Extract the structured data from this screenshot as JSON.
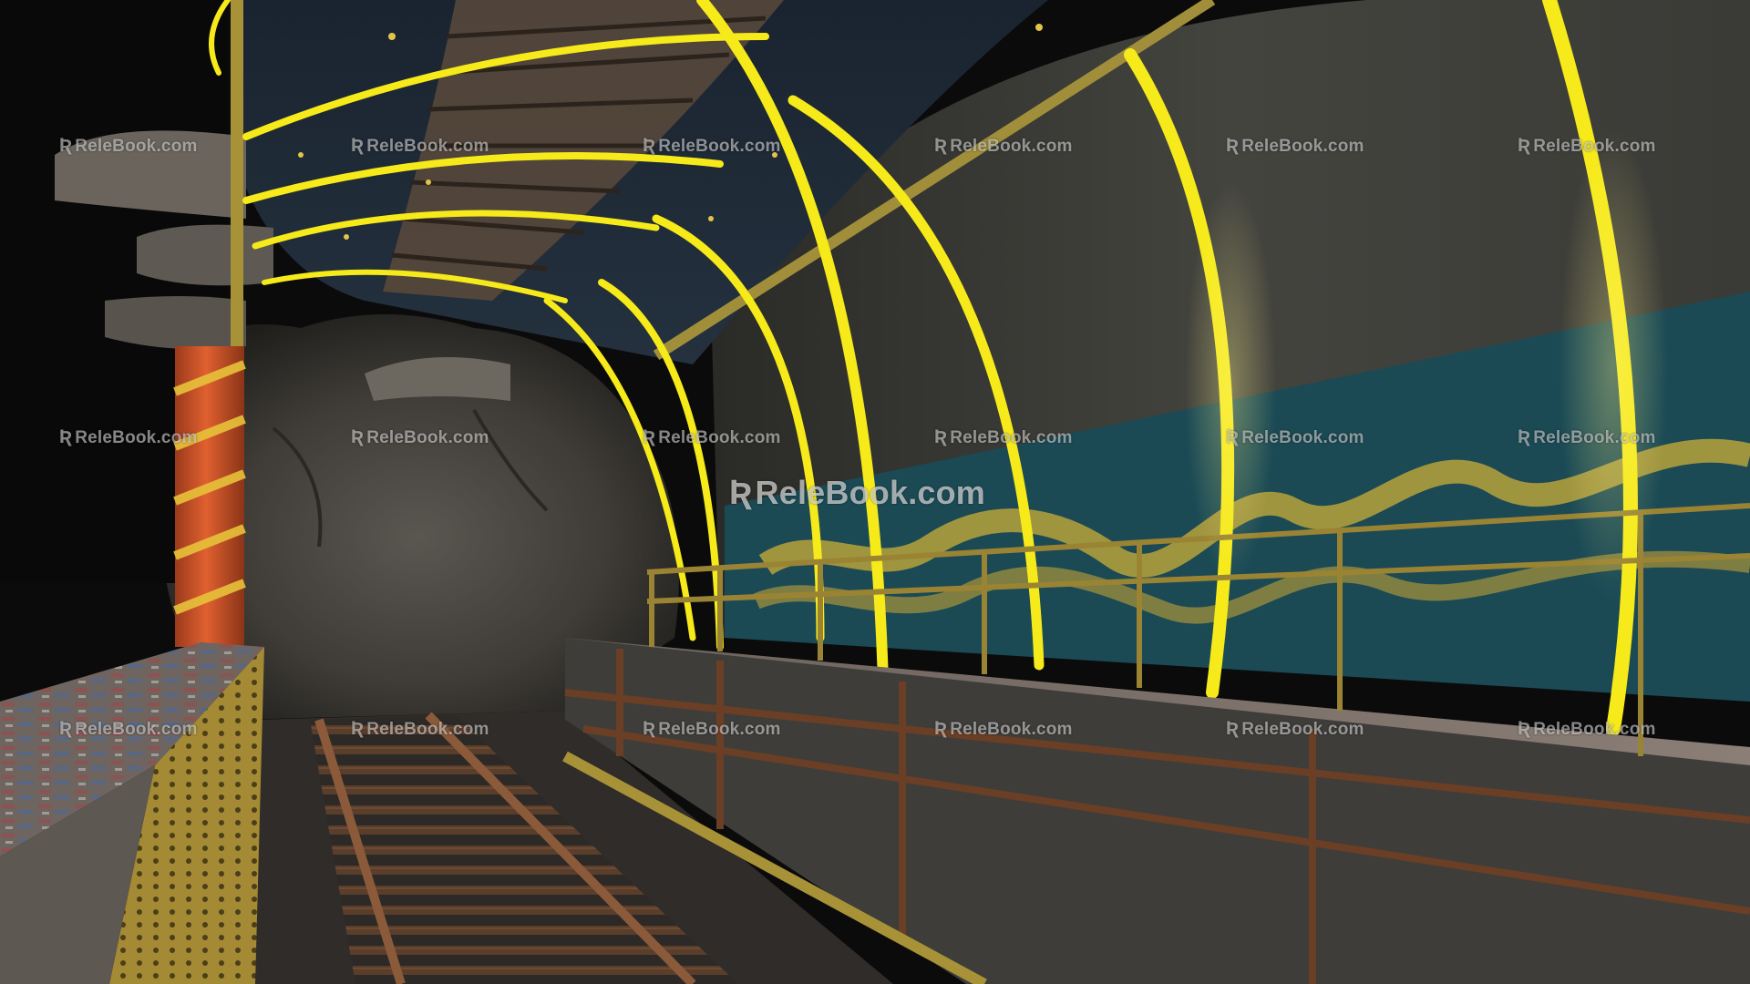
{
  "scene": {
    "subject": "Abandoned subway tunnel with platforms, rail track, rock face and glowing yellow arch lights",
    "colors": {
      "arch_light": "#f6ea1a",
      "tunnel_wall": "#3c3c38",
      "mural_teal": "#1a4a55",
      "mural_wave": "#b7a23c",
      "pillar_orange": "#d4532b",
      "pillar_stripe": "#e8c23a",
      "rail_rust": "#7a4a2e",
      "platform_edge": "#b89a3a",
      "background": "#0b0b0b"
    }
  },
  "watermark": {
    "brand": "ReleBook.com",
    "center_text": "ReleBook.com",
    "rows": 3,
    "cols": 6
  }
}
